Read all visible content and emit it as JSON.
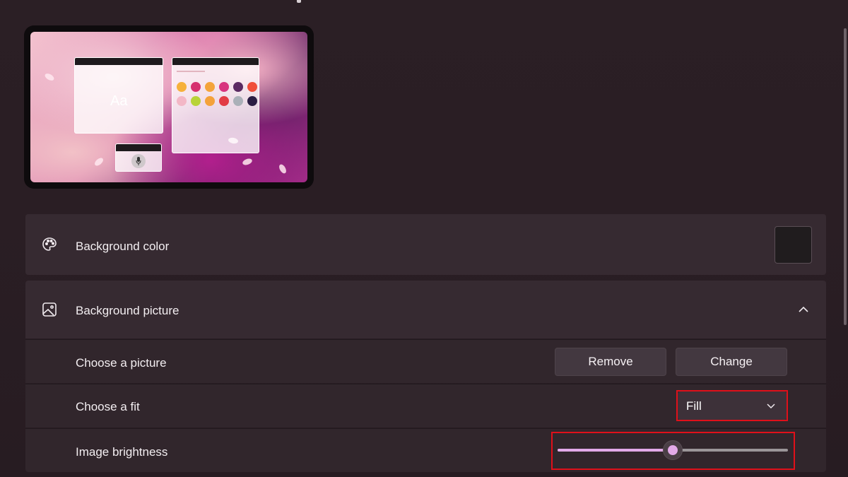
{
  "preview": {
    "sample_text": "Aa",
    "swatch_colors": [
      "#f6b13b",
      "#d6306f",
      "#f4a43a",
      "#d8347f",
      "#5b2a62",
      "#f04f3a",
      "#f3b7c6",
      "#b8d338",
      "#f4a23a",
      "#e23b45",
      "#aab0b8",
      "#2a1d43"
    ]
  },
  "background_color": {
    "label": "Background color",
    "icon": "palette-icon",
    "current_color": "#201c1e"
  },
  "background_picture": {
    "label": "Background picture",
    "icon": "image-icon",
    "expanded": true
  },
  "choose_picture": {
    "label": "Choose a picture",
    "remove_label": "Remove",
    "change_label": "Change"
  },
  "choose_fit": {
    "label": "Choose a fit",
    "selected": "Fill"
  },
  "image_brightness": {
    "label": "Image brightness",
    "value_fraction": 0.5
  },
  "colors": {
    "accent": "#e2a9e8",
    "highlight": "#e0101a"
  }
}
